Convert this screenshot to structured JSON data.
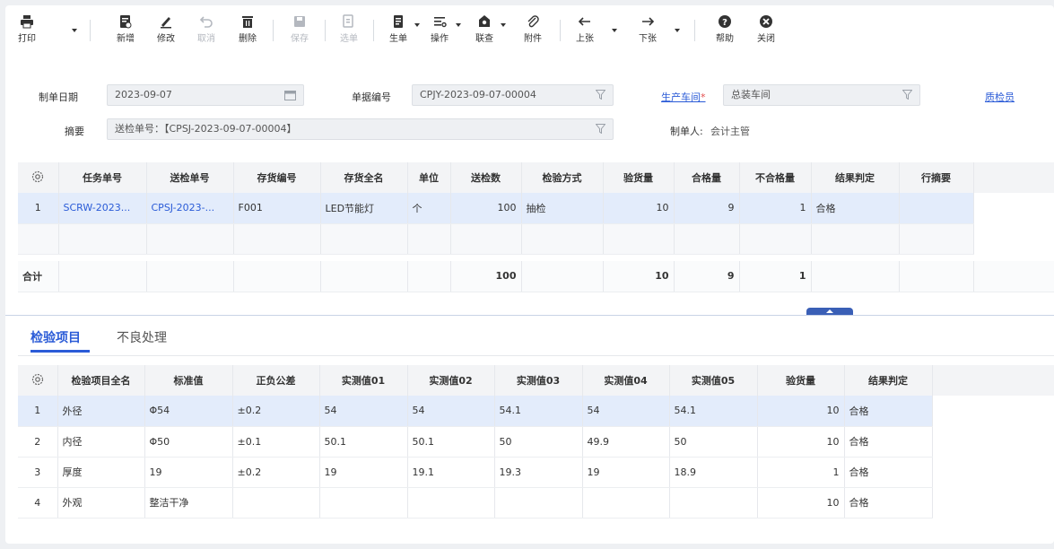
{
  "toolbar": {
    "print": "打印",
    "new": "新增",
    "edit": "修改",
    "cancel": "取消",
    "delete": "删除",
    "save": "保存",
    "select_doc": "选单",
    "gen_doc": "生单",
    "operate": "操作",
    "query": "联查",
    "attachment": "附件",
    "prev": "上张",
    "next": "下张",
    "help": "帮助",
    "close": "关闭"
  },
  "form": {
    "date_label": "制单日期",
    "date_value": "2023-09-07",
    "docno_label": "单据编号",
    "docno_value": "CPJY-2023-09-07-00004",
    "workshop_label": "生产车间",
    "workshop_required": "*",
    "workshop_value": "总装车间",
    "inspector_label": "质检员",
    "summary_label": "摘要",
    "summary_value": "送检单号：【CPSJ-2023-09-07-00004】",
    "maker_label": "制单人:",
    "maker_value": "会计主管"
  },
  "main_table": {
    "headers": [
      "任务单号",
      "送检单号",
      "存货编号",
      "存货全名",
      "单位",
      "送检数",
      "检验方式",
      "验货量",
      "合格量",
      "不合格量",
      "结果判定",
      "行摘要"
    ],
    "rows": [
      {
        "index": "1",
        "task_no": "SCRW-2023...",
        "submit_no": "CPSJ-2023-...",
        "item_code": "F001",
        "item_name": "LED节能灯",
        "unit": "个",
        "qty": "100",
        "method": "抽检",
        "inspected": "10",
        "qualified": "9",
        "unqualified": "1",
        "result": "合格",
        "memo": ""
      }
    ],
    "totals": {
      "label": "合计",
      "qty": "100",
      "inspected": "10",
      "qualified": "9",
      "unqualified": "1"
    }
  },
  "tabs": {
    "inspection_items": "检验项目",
    "defect_handling": "不良处理"
  },
  "detail_table": {
    "headers": [
      "检验项目全名",
      "标准值",
      "正负公差",
      "实测值01",
      "实测值02",
      "实测值03",
      "实测值04",
      "实测值05",
      "验货量",
      "结果判定"
    ],
    "rows": [
      {
        "index": "1",
        "name": "外径",
        "std": "Φ54",
        "tol": "±0.2",
        "m1": "54",
        "m2": "54",
        "m3": "54.1",
        "m4": "54",
        "m5": "54.1",
        "qty": "10",
        "result": "合格"
      },
      {
        "index": "2",
        "name": "内径",
        "std": "Φ50",
        "tol": "±0.1",
        "m1": "50.1",
        "m2": "50.1",
        "m3": "50",
        "m4": "49.9",
        "m5": "50",
        "qty": "10",
        "result": "合格"
      },
      {
        "index": "3",
        "name": "厚度",
        "std": "19",
        "tol": "±0.2",
        "m1": "19",
        "m2": "19.1",
        "m3": "19.3",
        "m4": "19",
        "m5": "18.9",
        "qty": "1",
        "result": "合格"
      },
      {
        "index": "4",
        "name": "外观",
        "std": "整洁干净",
        "tol": "",
        "m1": "",
        "m2": "",
        "m3": "",
        "m4": "",
        "m5": "",
        "qty": "10",
        "result": "合格"
      }
    ]
  },
  "colors": {
    "accent": "#2a5bd7",
    "selected_row": "#e3ecfb",
    "header_bg": "#f3f4f6",
    "field_bg": "#eef0f3"
  }
}
